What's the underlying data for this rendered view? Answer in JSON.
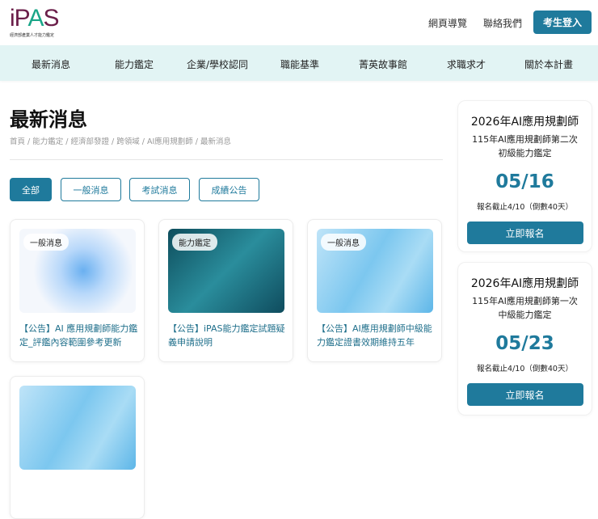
{
  "header": {
    "logo_text": "iPAS",
    "logo_sub": "經濟部產業人才能力鑑定",
    "links": [
      "網頁導覽",
      "聯絡我們"
    ],
    "login": "考生登入"
  },
  "nav": [
    "最新消息",
    "能力鑑定",
    "企業/學校認同",
    "職能基準",
    "菁英故事館",
    "求職求才",
    "關於本計畫"
  ],
  "page": {
    "title": "最新消息",
    "breadcrumb": "首頁 / 能力鑑定 / 經濟部發證 / 跨領域 / AI應用規劃師 / 最新消息"
  },
  "filters": [
    "全部",
    "一般消息",
    "考試消息",
    "成績公告"
  ],
  "cards": [
    {
      "tag": "一般消息",
      "title": "【公告】AI 應用規劃師能力鑑定_評鑑內容範圍參考更新"
    },
    {
      "tag": "能力鑑定",
      "title": "【公告】iPAS能力鑑定試題疑義申請說明"
    },
    {
      "tag": "一般消息",
      "title": "【公告】AI應用規劃師中級能力鑑定證書效期維持五年"
    }
  ],
  "sidebar": [
    {
      "title": "2026年AI應用規劃師",
      "subtitle": "115年AI應用規劃師第二次初級能力鑑定",
      "date": "05/16",
      "deadline": "報名截止4/10（倒數40天）",
      "button": "立即報名"
    },
    {
      "title": "2026年AI應用規劃師",
      "subtitle": "115年AI應用規劃師第一次中級能力鑑定",
      "date": "05/23",
      "deadline": "報名截止4/10（倒數40天）",
      "button": "立即報名"
    }
  ],
  "colors": {
    "accent": "#1f7a9c",
    "nav_bg": "#e2f4f4"
  }
}
